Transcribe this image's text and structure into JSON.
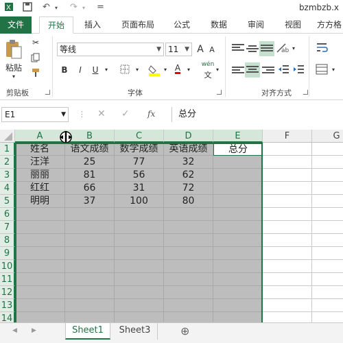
{
  "window": {
    "title": "bzmbzb.x"
  },
  "quick_access": {
    "more": "="
  },
  "tabs": [
    "文件",
    "开始",
    "插入",
    "页面布局",
    "公式",
    "数据",
    "审阅",
    "视图",
    "方方格"
  ],
  "ribbon": {
    "clipboard": {
      "paste": "粘贴",
      "group": "剪贴板"
    },
    "font": {
      "name": "等线",
      "size": "11",
      "bold": "B",
      "italic": "I",
      "underline": "U",
      "grow": "A",
      "shrink": "A",
      "font_color": "A",
      "phonetic": "wén",
      "group": "字体"
    },
    "alignment": {
      "group": "对齐方式"
    }
  },
  "formula_bar": {
    "name_box": "E1",
    "fx": "fx",
    "content": "总分"
  },
  "columns": [
    "A",
    "B",
    "C",
    "D",
    "E",
    "F",
    "G"
  ],
  "rows": [
    "1",
    "2",
    "3",
    "4",
    "5",
    "6",
    "7",
    "8",
    "9",
    "10",
    "11",
    "12",
    "13",
    "14"
  ],
  "cells": [
    [
      "姓名",
      "语文成绩",
      "数学成绩",
      "英语成绩",
      "总分"
    ],
    [
      "汪洋",
      "25",
      "77",
      "32",
      ""
    ],
    [
      "丽丽",
      "81",
      "56",
      "62",
      ""
    ],
    [
      "红红",
      "66",
      "31",
      "72",
      ""
    ],
    [
      "明明",
      "37",
      "100",
      "80",
      ""
    ]
  ],
  "sheets": [
    "Sheet1",
    "Sheet3"
  ],
  "add_sheet": "⊕",
  "nav": {
    "prev": "◀",
    "next": "▶"
  },
  "colors": {
    "accent": "#217346",
    "selection": "#bdbdbd"
  }
}
